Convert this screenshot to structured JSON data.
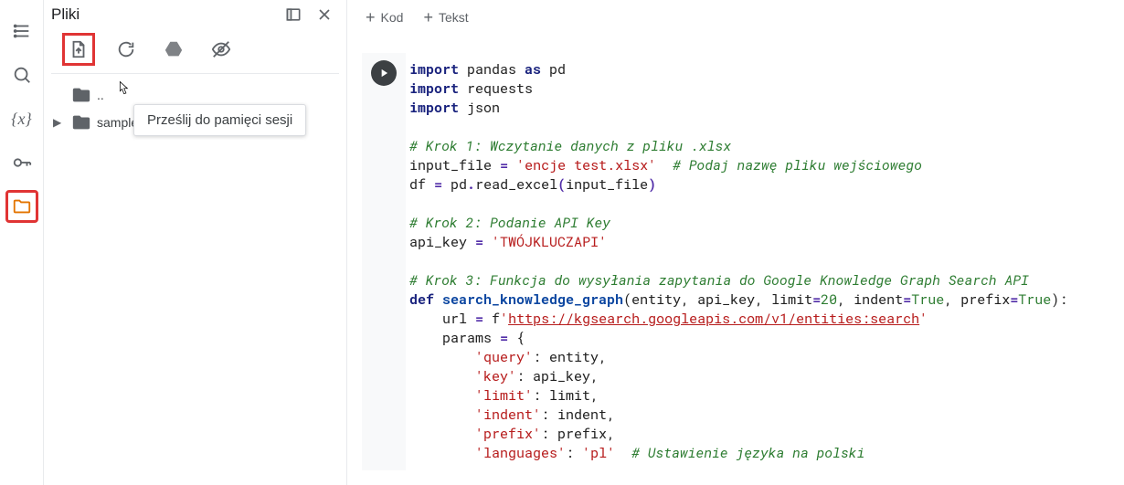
{
  "sidebar": {
    "title": "Pliki",
    "upload_tooltip": "Prześlij do pamięci sesji"
  },
  "tree": {
    "folder_icon": "folder",
    "folder_label": "sample_data"
  },
  "icons": {
    "toc": "toc-icon",
    "search": "search-icon",
    "vars": "variables-icon",
    "key": "key-icon",
    "files": "files-icon",
    "upload": "upload-icon",
    "refresh": "refresh-icon",
    "drive": "drive-icon",
    "hide": "hide-icon",
    "openwin": "open-window-icon",
    "close": "close-icon",
    "run": "run-icon"
  },
  "top": {
    "kod": "Kod",
    "tekst": "Tekst"
  },
  "code": {
    "l1": {
      "kw1": "import",
      "t1": " pandas ",
      "kw2": "as",
      "t2": " pd"
    },
    "l2": {
      "kw": "import",
      "t": " requests"
    },
    "l3": {
      "kw": "import",
      "t": " json"
    },
    "l4": "# Krok 1: Wczytanie danych z pliku .xlsx",
    "l5": {
      "a": "input_file ",
      "op": "=",
      "b": " ",
      "s": "'encje test.xlsx'",
      "c": "  ",
      "cm": "# Podaj nazwę pliku wejściowego"
    },
    "l6": {
      "a": "df ",
      "op": "=",
      "b": " pd",
      "p1": ".",
      "fn": "read_excel",
      "p2": "(",
      "c": "input_file",
      "p3": ")"
    },
    "l7": "# Krok 2: Podanie API Key",
    "l8": {
      "a": "api_key ",
      "op": "=",
      "b": " ",
      "s": "'TWÓJKLUCZAPI'"
    },
    "l9": "# Krok 3: Funkcja do wysyłania zapytania do Google Knowledge Graph Search API",
    "l10": {
      "kw": "def",
      "sp": " ",
      "fn": "search_knowledge_graph",
      "args": "(entity, api_key, limit",
      "eq1": "=",
      "n1": "20",
      "c1": ", indent",
      "eq2": "=",
      "t1": "True",
      "c2": ", prefix",
      "eq3": "=",
      "t2": "True",
      "end": "):"
    },
    "l11": {
      "pad": "    ",
      "a": "url ",
      "op": "=",
      "b": " f",
      "s": "'",
      "url": "https://kgsearch.googleapis.com/v1/entities:search",
      "s2": "'"
    },
    "l12": {
      "pad": "    ",
      "a": "params ",
      "op": "=",
      "b": " {"
    },
    "l13": {
      "pad": "        ",
      "k": "'query'",
      "c": ": entity,"
    },
    "l14": {
      "pad": "        ",
      "k": "'key'",
      "c": ": api_key,"
    },
    "l15": {
      "pad": "        ",
      "k": "'limit'",
      "c": ": limit,"
    },
    "l16": {
      "pad": "        ",
      "k": "'indent'",
      "c": ": indent,"
    },
    "l17": {
      "pad": "        ",
      "k": "'prefix'",
      "c": ": prefix,"
    },
    "l18": {
      "pad": "        ",
      "k": "'languages'",
      "c": ": ",
      "v": "'pl'",
      "sp": "  ",
      "cm": "# Ustawienie języka na polski"
    }
  }
}
